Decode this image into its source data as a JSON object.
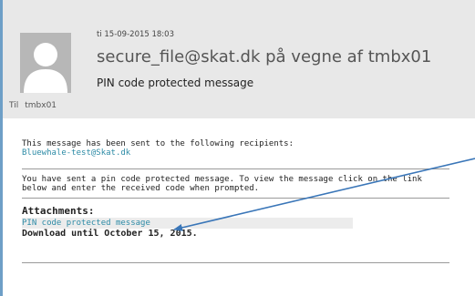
{
  "header": {
    "timestamp": "ti 15-09-2015 18:03",
    "sender": "secure_file@skat.dk på vegne af tmbx01",
    "subject": "PIN code protected message",
    "to_label": "Til",
    "to_name": "tmbx01"
  },
  "body": {
    "recipients_intro": "This message has been sent to the following recipients:",
    "recipient": "Bluewhale-test@Skat.dk",
    "info_line1": "You have sent a pin code protected message. To view the message click on the link",
    "info_line2": "below and enter the received code when prompted.",
    "attachments_title": "Attachments:",
    "attachment_link": "PIN code protected message",
    "download_until": "Download until October 15, 2015."
  },
  "colors": {
    "link": "#2d8ba6",
    "annotation_arrow": "#3a76b8",
    "header_bg": "#e8e8e8"
  }
}
